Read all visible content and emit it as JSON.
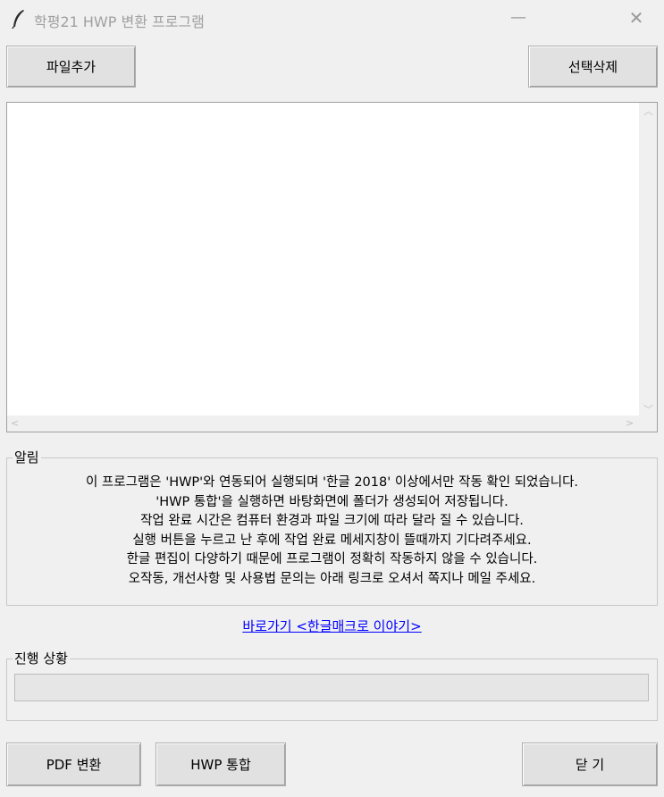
{
  "window": {
    "title": "학평21 HWP 변환 프로그램",
    "minimize_glyph": "—",
    "close_glyph": "✕"
  },
  "toolbar": {
    "add_files_label": "파일추가",
    "delete_selected_label": "선택삭제"
  },
  "file_list": {
    "items": []
  },
  "notice": {
    "label": "알림",
    "lines": [
      "이 프로그램은 'HWP'와 연동되어 실행되며 '한글 2018' 이상에서만 작동 확인 되었습니다.",
      "'HWP 통합'을 실행하면 바탕화면에 폴더가 생성되어 저장됩니다.",
      "작업 완료 시간은 컴퓨터 환경과 파일 크기에 따라 달라 질 수 있습니다.",
      "실행 버튼을 누르고 난 후에 작업 완료 메세지창이 뜰때까지 기다려주세요.",
      "한글 편집이 다양하기 때문에 프로그램이 정확히 작동하지 않을 수 있습니다.",
      "오작동, 개선사항 및 사용법 문의는 아래 링크로 오셔서 쪽지나 메일 주세요."
    ]
  },
  "link": {
    "text": "바로가기 <한글매크로 이야기>"
  },
  "progress": {
    "label": "진행 상황",
    "value": 0
  },
  "actions": {
    "pdf_convert_label": "PDF 변환",
    "hwp_merge_label": "HWP 통합",
    "close_label": "닫 기"
  }
}
